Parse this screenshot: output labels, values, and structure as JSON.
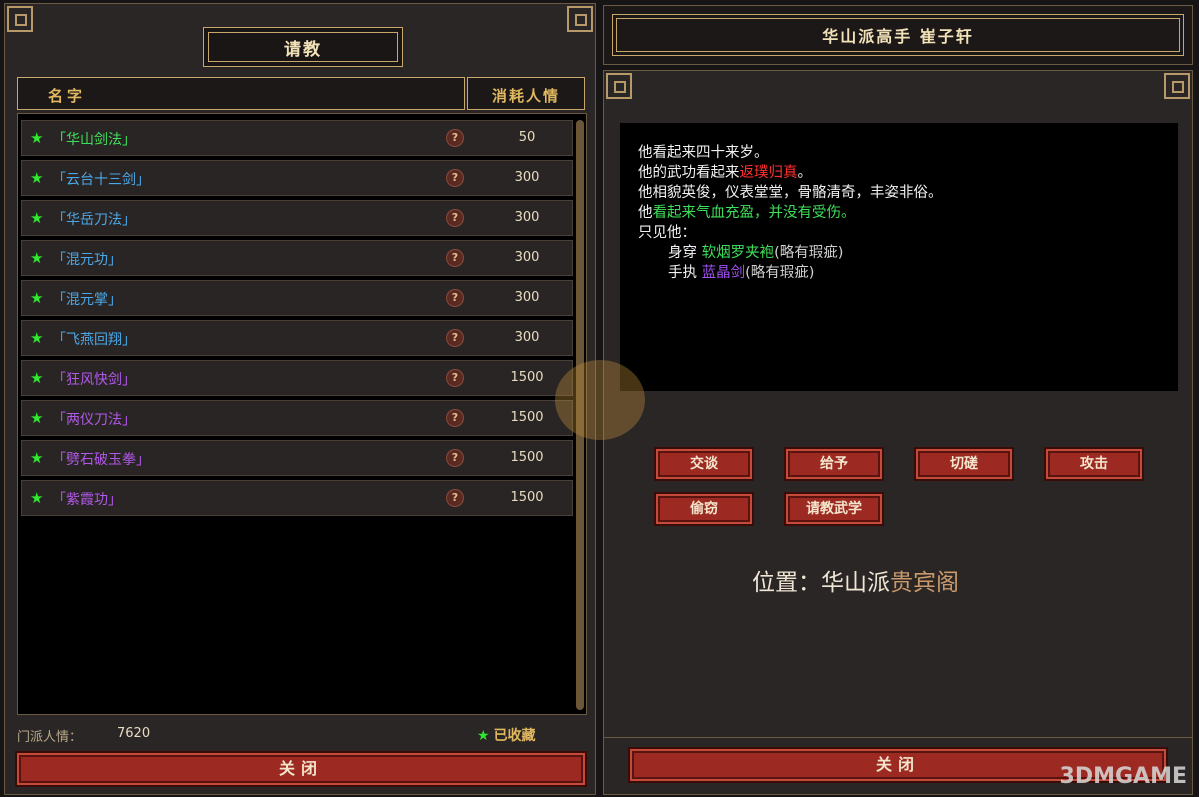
{
  "left_panel": {
    "title": "请教",
    "col_name": "名字",
    "col_cost": "消耗人情",
    "help_glyph": "?",
    "skills": [
      {
        "name": "「华山剑法」",
        "cost": "50",
        "color": "#3ee05a"
      },
      {
        "name": "「云台十三剑」",
        "cost": "300",
        "color": "#4aa8e8"
      },
      {
        "name": "「华岳刀法」",
        "cost": "300",
        "color": "#4aa8e8"
      },
      {
        "name": "「混元功」",
        "cost": "300",
        "color": "#4aa8e8"
      },
      {
        "name": "「混元掌」",
        "cost": "300",
        "color": "#4aa8e8"
      },
      {
        "name": "「飞燕回翔」",
        "cost": "300",
        "color": "#4aa8e8"
      },
      {
        "name": "「狂风快剑」",
        "cost": "1500",
        "color": "#b058e8"
      },
      {
        "name": "「两仪刀法」",
        "cost": "1500",
        "color": "#b058e8"
      },
      {
        "name": "「劈石破玉拳」",
        "cost": "1500",
        "color": "#b058e8"
      },
      {
        "name": "「紫霞功」",
        "cost": "1500",
        "color": "#b058e8"
      }
    ],
    "sect_favor_label": "门派人情：",
    "sect_favor_value": "7620",
    "favorited_label": "已收藏",
    "close_label": "关闭"
  },
  "right_panel": {
    "title": "华山派高手  崔子轩",
    "desc": {
      "l1": "他看起来四十来岁。",
      "l2_a": "他的武功看起来",
      "l2_b": "返璞归真",
      "l2_c": "。",
      "l3": "他相貌英俊，仪表堂堂，骨骼清奇，丰姿非俗。",
      "l4_a": "他",
      "l4_b": "看起来气血充盈，并没有受伤。",
      "l5": "只见他：",
      "l6_a": "身穿 ",
      "l6_b": "软烟罗夹袍",
      "l6_c": "(略有瑕疵)",
      "l7_a": "手执 ",
      "l7_b": "蓝晶剑",
      "l7_c": "(略有瑕疵)"
    },
    "actions": [
      "交谈",
      "给予",
      "切磋",
      "攻击",
      "偷窃",
      "请教武学"
    ],
    "location_label": "位置：华山派",
    "location_place": "贵宾阁",
    "close_label": "关闭"
  },
  "watermark": "3DMGAME",
  "colors": {
    "accent_gold": "#c8a86a",
    "button_red": "#9c2a22",
    "tier_green": "#3ee05a",
    "tier_blue": "#4aa8e8",
    "tier_purple": "#b058e8"
  }
}
